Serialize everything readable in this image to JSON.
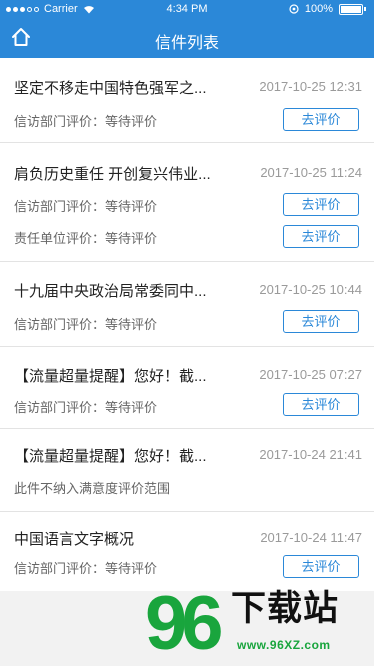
{
  "status_bar": {
    "carrier": "Carrier",
    "time": "4:34 PM",
    "battery": "100%"
  },
  "header": {
    "title": "信件列表",
    "home_icon": "home-icon"
  },
  "letters": [
    {
      "title": "坚定不移走中国特色强军之...",
      "date": "2017-10-25 12:31",
      "ratings": [
        {
          "label": "信访部门评价：等待评价",
          "button": "去评价"
        }
      ]
    },
    {
      "title": "肩负历史重任 开创复兴伟业...",
      "date": "2017-10-25 11:24",
      "ratings": [
        {
          "label": "信访部门评价：等待评价",
          "button": "去评价"
        },
        {
          "label": "责任单位评价：等待评价",
          "button": "去评价"
        }
      ]
    },
    {
      "title": "十九届中央政治局常委同中...",
      "date": "2017-10-25 10:44",
      "ratings": [
        {
          "label": "信访部门评价：等待评价",
          "button": "去评价"
        }
      ]
    },
    {
      "title": "【流量超量提醒】您好！截...",
      "date": "2017-10-25 07:27",
      "ratings": [
        {
          "label": "信访部门评价：等待评价",
          "button": "去评价"
        }
      ]
    },
    {
      "title": "【流量超量提醒】您好！截...",
      "date": "2017-10-24 21:41",
      "ratings": [
        {
          "label": "此件不纳入满意度评价范围"
        }
      ]
    },
    {
      "title": "中国语言文字概况",
      "date": "2017-10-24 11:47",
      "ratings": [
        {
          "label": "信访部门评价：等待评价",
          "button": "去评价"
        }
      ]
    }
  ],
  "watermark": {
    "number": "96",
    "text": "下载站",
    "url": "www.96XZ.com"
  },
  "colors": {
    "primary": "#2b88d8",
    "watermark_green": "#19a53d"
  }
}
